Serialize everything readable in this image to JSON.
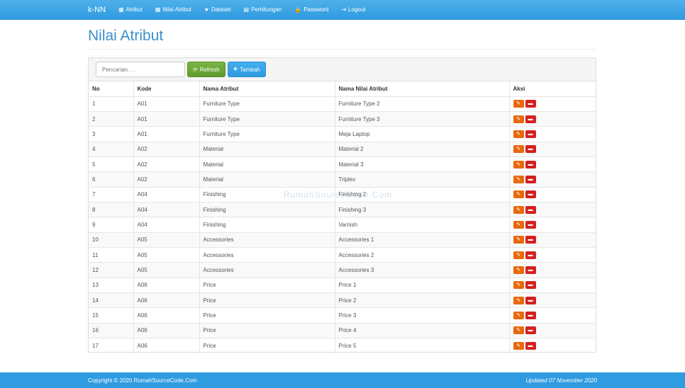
{
  "nav": {
    "brand": "k-NN",
    "items": [
      {
        "label": "Atribut",
        "icon": "th-large-icon",
        "glyph": "▦"
      },
      {
        "label": "Nilai Atribut",
        "icon": "th-icon",
        "glyph": "▦"
      },
      {
        "label": "Dataset",
        "icon": "star-icon",
        "glyph": "★"
      },
      {
        "label": "Perhitungan",
        "icon": "calendar-icon",
        "glyph": "▤"
      },
      {
        "label": "Password",
        "icon": "lock-icon",
        "glyph": "🔒"
      },
      {
        "label": "Logout",
        "icon": "logout-icon",
        "glyph": "⇥"
      }
    ]
  },
  "page": {
    "title": "Nilai Atribut"
  },
  "toolbar": {
    "search_placeholder": "Pencarian. . .",
    "refresh_label": "Refresh",
    "add_label": "Tambah"
  },
  "table": {
    "headers": [
      "No",
      "Kode",
      "Nama Atribut",
      "Nama Nilai Atribut",
      "Aksi"
    ],
    "rows": [
      [
        "1",
        "A01",
        "Furniture Type",
        "Furniture Type 2"
      ],
      [
        "2",
        "A01",
        "Furniture Type",
        "Furniture Type 3"
      ],
      [
        "3",
        "A01",
        "Furniture Type",
        "Meja Laptop"
      ],
      [
        "4",
        "A02",
        "Material",
        "Material 2"
      ],
      [
        "5",
        "A02",
        "Material",
        "Material 3"
      ],
      [
        "6",
        "A02",
        "Material",
        "Triplex"
      ],
      [
        "7",
        "A04",
        "Finishing",
        "Finishing 2"
      ],
      [
        "8",
        "A04",
        "Finishing",
        "Finishing 3"
      ],
      [
        "9",
        "A04",
        "Finishing",
        "Varnish"
      ],
      [
        "10",
        "A05",
        "Accessories",
        "Accessories 1"
      ],
      [
        "11",
        "A05",
        "Accessories",
        "Accessories 2"
      ],
      [
        "12",
        "A05",
        "Accessories",
        "Accessories 3"
      ],
      [
        "13",
        "A06",
        "Price",
        "Price 1"
      ],
      [
        "14",
        "A06",
        "Price",
        "Price 2"
      ],
      [
        "15",
        "A06",
        "Price",
        "Price 3"
      ],
      [
        "16",
        "A06",
        "Price",
        "Price 4"
      ],
      [
        "17",
        "A06",
        "Price",
        "Price 5"
      ]
    ]
  },
  "watermark": "RumahSourceCode.Com",
  "footer": {
    "copyright": "Copyright © 2020 RumahSourceCode.Com",
    "updated": "Updated 07 November 2020"
  },
  "colors": {
    "primary": "#2f9be0",
    "success": "#5e9a2e",
    "edit": "#e8690c",
    "delete": "#d42020"
  }
}
